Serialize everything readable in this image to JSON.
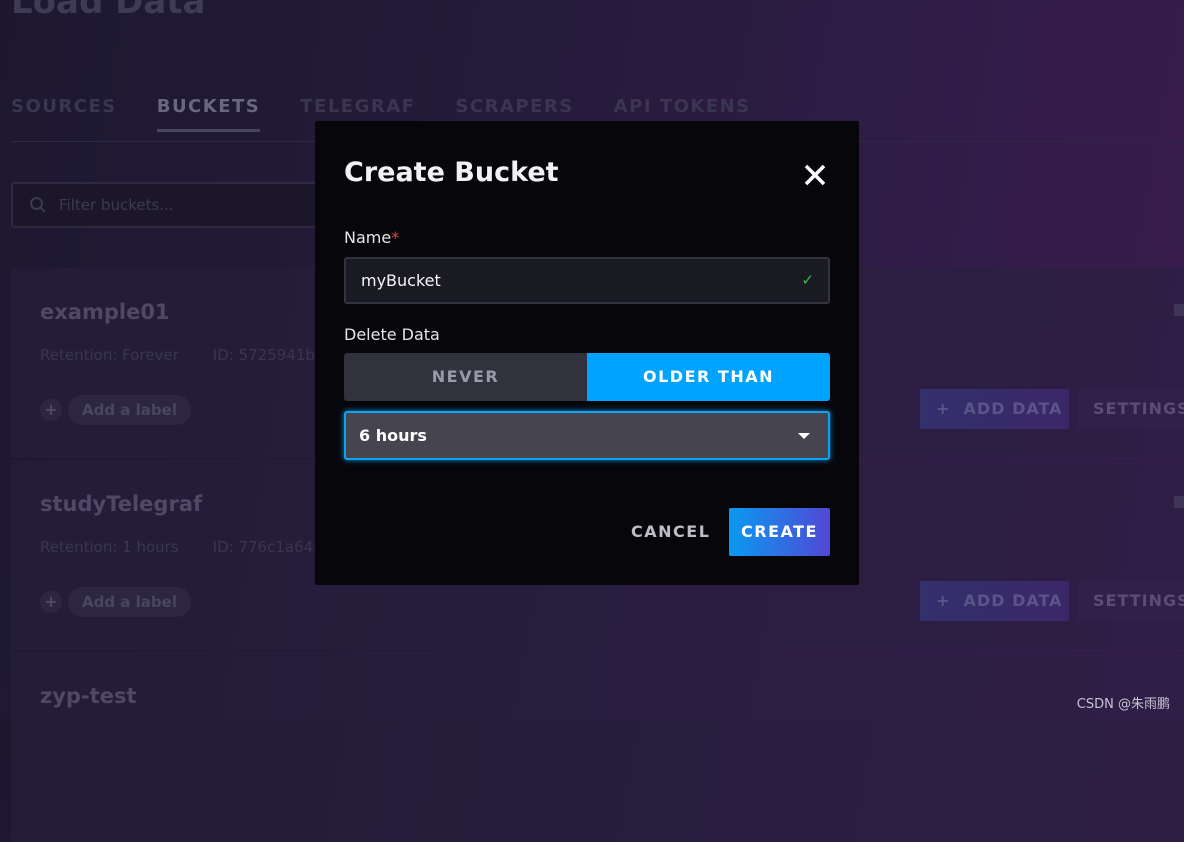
{
  "page": {
    "title": "Load Data"
  },
  "tabs": [
    {
      "label": "SOURCES"
    },
    {
      "label": "BUCKETS",
      "active": true
    },
    {
      "label": "TELEGRAF"
    },
    {
      "label": "SCRAPERS"
    },
    {
      "label": "API TOKENS"
    }
  ],
  "search": {
    "placeholder": "Filter buckets..."
  },
  "buckets": [
    {
      "name": "example01",
      "retention": "Retention: Forever",
      "id": "ID: 5725941b",
      "add_label": "Add a label",
      "add_data": "ADD DATA",
      "settings": "SETTINGS"
    },
    {
      "name": "studyTelegraf",
      "retention": "Retention: 1 hours",
      "id": "ID: 776c1a64",
      "add_label": "Add a label",
      "add_data": "ADD DATA",
      "settings": "SETTINGS"
    },
    {
      "name": "zyp-test"
    }
  ],
  "modal": {
    "title": "Create Bucket",
    "name_label": "Name",
    "required_mark": "*",
    "name_value": "myBucket",
    "delete_label": "Delete Data",
    "never": "NEVER",
    "older_than": "OLDER THAN",
    "selected_option": "older_than",
    "duration": "6 hours",
    "cancel": "CANCEL",
    "create": "CREATE"
  },
  "watermark": "CSDN @朱雨鹏",
  "colors": {
    "accent": "#00a3ff",
    "valid": "#34bb55",
    "required": "#e0454d"
  }
}
